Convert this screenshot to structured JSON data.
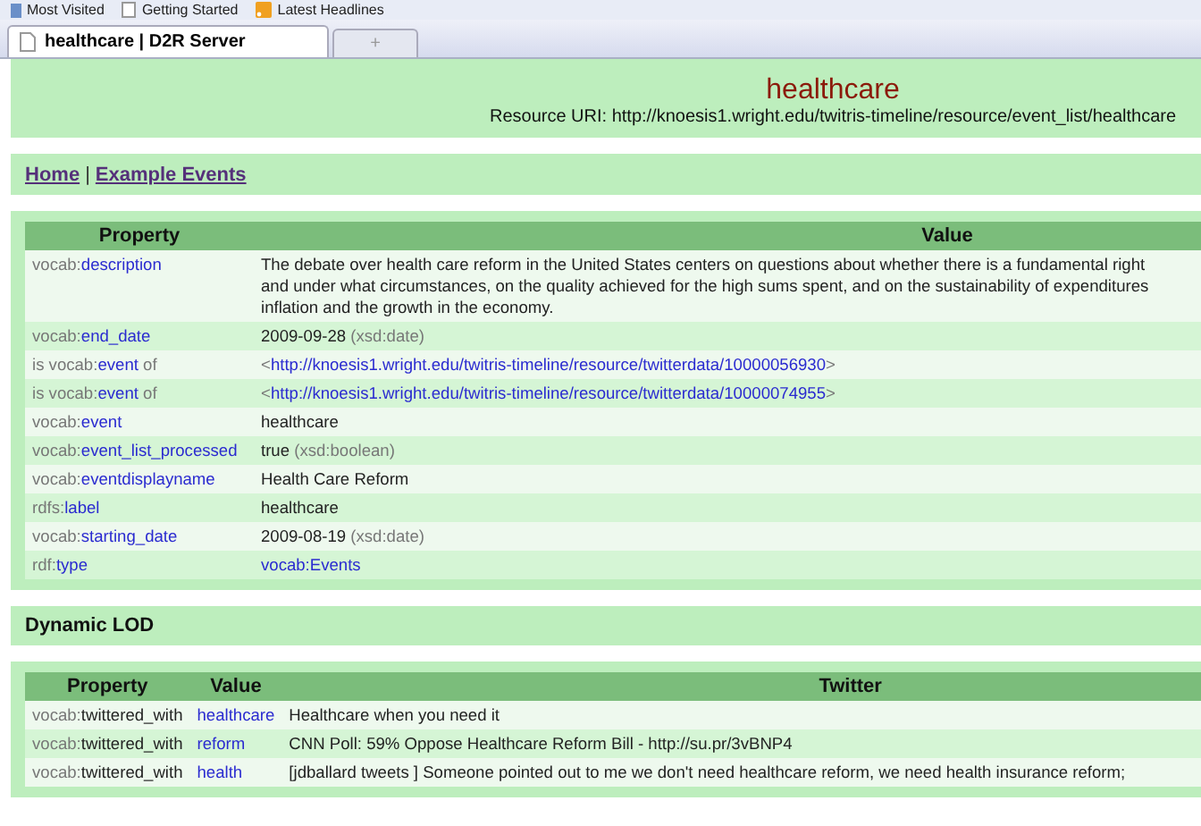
{
  "bookmarks": [
    {
      "label": "Most Visited"
    },
    {
      "label": "Getting Started"
    },
    {
      "label": "Latest Headlines"
    }
  ],
  "tabs": [
    {
      "label": "healthcare | D2R Server",
      "selected": true
    }
  ],
  "new_tab": "+",
  "header": {
    "title": "healthcare",
    "resource_label": "Resource URI:",
    "resource_uri": "http://knoesis1.wright.edu/twitris-timeline/resource/event_list/healthcare"
  },
  "nav": [
    {
      "label": "Home"
    },
    {
      "label": "Example Events"
    }
  ],
  "nav_separator": "|",
  "properties": {
    "columns": [
      "Property",
      "Value"
    ],
    "rows": [
      {
        "property": {
          "before": "vocab:",
          "name": "description"
        },
        "value": {
          "kind": "text",
          "lines": [
            "The debate over health care reform in the United States centers on questions about whether there is a fundamental right",
            "and under what circumstances, on the quality achieved for the high sums spent, and on the sustainability of expenditures",
            "inflation and the growth in the economy."
          ]
        }
      },
      {
        "property": {
          "before": "vocab:",
          "name": "end_date"
        },
        "value": {
          "kind": "typed",
          "text": "2009-09-28",
          "datatype": "(xsd:date)"
        }
      },
      {
        "property": {
          "before": "is vocab:",
          "name": "event",
          "after": " of"
        },
        "value": {
          "kind": "uri",
          "text": "http://knoesis1.wright.edu/twitris-timeline/resource/twitterdata/10000056930",
          "open": "<",
          "close": ">"
        }
      },
      {
        "property": {
          "before": "is vocab:",
          "name": "event",
          "after": " of"
        },
        "value": {
          "kind": "uri",
          "text": "http://knoesis1.wright.edu/twitris-timeline/resource/twitterdata/10000074955",
          "open": "<",
          "close": ">"
        }
      },
      {
        "property": {
          "before": "vocab:",
          "name": "event"
        },
        "value": {
          "kind": "text",
          "lines": [
            "healthcare"
          ]
        }
      },
      {
        "property": {
          "before": "vocab:",
          "name": "event_list_processed"
        },
        "value": {
          "kind": "typed",
          "text": "true",
          "datatype": "(xsd:boolean)"
        }
      },
      {
        "property": {
          "before": "vocab:",
          "name": "eventdisplayname"
        },
        "value": {
          "kind": "text",
          "lines": [
            "Health Care Reform"
          ]
        }
      },
      {
        "property": {
          "before": "rdfs:",
          "name": "label"
        },
        "value": {
          "kind": "text",
          "lines": [
            "healthcare"
          ]
        }
      },
      {
        "property": {
          "before": "vocab:",
          "name": "starting_date"
        },
        "value": {
          "kind": "typed",
          "text": "2009-08-19",
          "datatype": "(xsd:date)"
        }
      },
      {
        "property": {
          "before": "rdf:",
          "name": "type"
        },
        "value": {
          "kind": "link",
          "text": "vocab:Events"
        }
      }
    ]
  },
  "lod_title": "Dynamic LOD",
  "lod": {
    "columns": [
      "Property",
      "Value",
      "Twitter"
    ],
    "rows": [
      {
        "property": {
          "before": "vocab:",
          "name": "twittered_with"
        },
        "value": "healthcare",
        "tweet": "Healthcare when you need it"
      },
      {
        "property": {
          "before": "vocab:",
          "name": "twittered_with"
        },
        "value": "reform",
        "tweet": "CNN Poll: 59% Oppose Healthcare Reform Bill - http://su.pr/3vBNP4"
      },
      {
        "property": {
          "before": "vocab:",
          "name": "twittered_with"
        },
        "value": "health",
        "tweet": "[jdballard tweets ] Someone pointed out to me we don't need healthcare reform, we need health insurance reform;"
      }
    ]
  }
}
